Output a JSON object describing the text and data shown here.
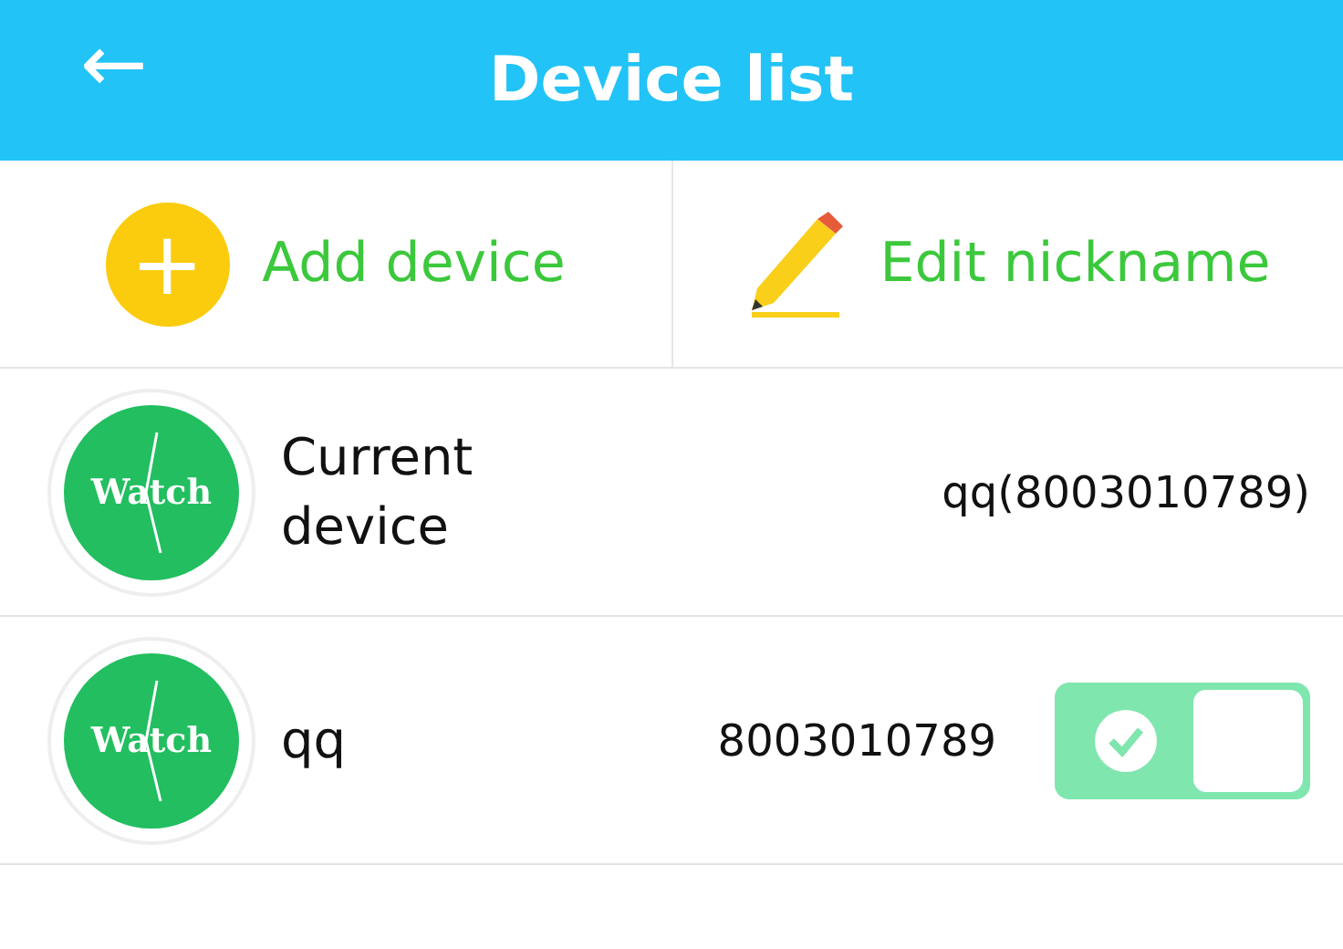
{
  "header": {
    "back": "←",
    "title": "Device list"
  },
  "actions": [
    {
      "kind": "add",
      "label": "Add device",
      "symbol": "+"
    },
    {
      "kind": "edit",
      "label": "Edit nickname"
    }
  ],
  "devices": [
    {
      "kind": "current",
      "logo_text": "Watch",
      "name": "Current device",
      "number": "qq(8003010789)"
    },
    {
      "kind": "toggle",
      "logo_text": "Watch",
      "name": "qq",
      "number": "8003010789",
      "on": true
    }
  ]
}
